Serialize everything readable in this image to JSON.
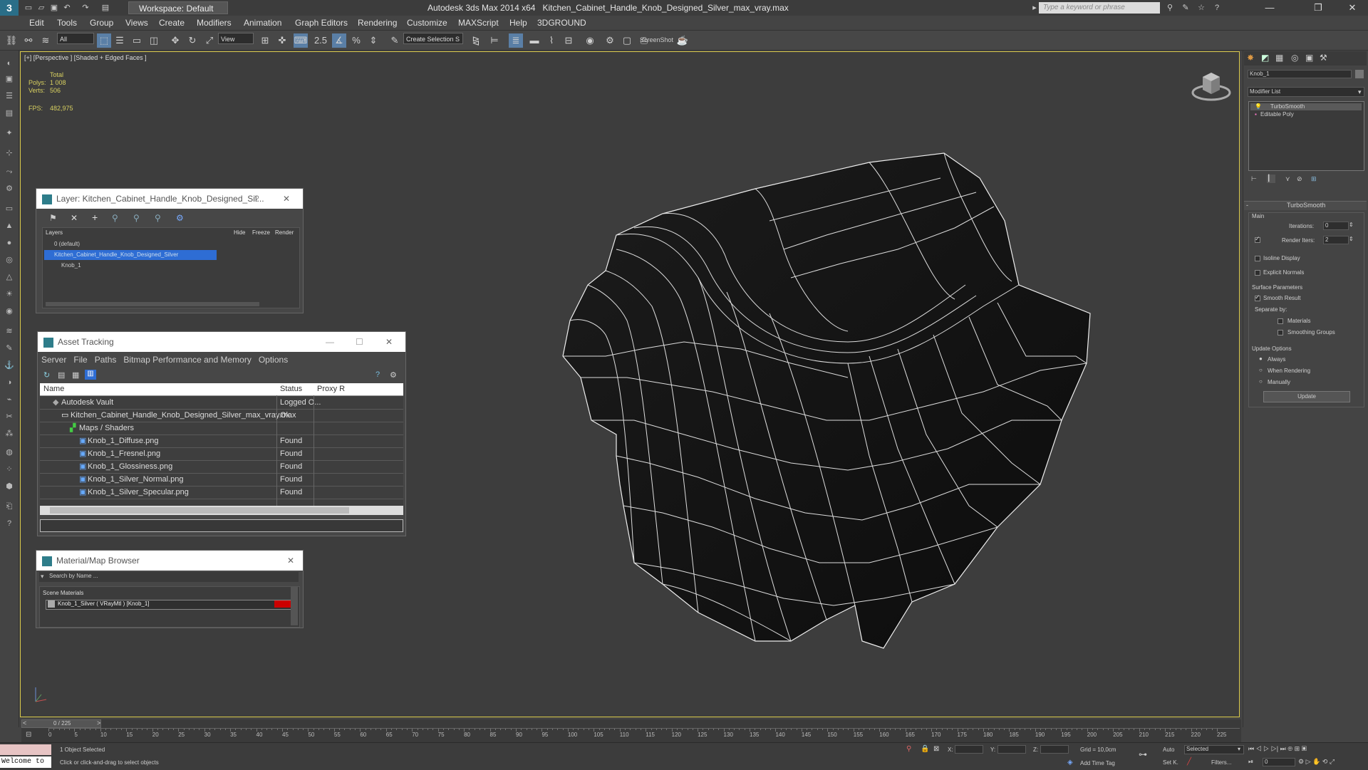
{
  "titlebar": {
    "workspace": "Workspace: Default",
    "app": "Autodesk 3ds Max  2014 x64",
    "file": "Kitchen_Cabinet_Handle_Knob_Designed_Silver_max_vray.max",
    "search_placeholder": "Type a keyword or phrase"
  },
  "menu": [
    "Edit",
    "Tools",
    "Group",
    "Views",
    "Create",
    "Modifiers",
    "Animation",
    "Graph Editors",
    "Rendering",
    "Customize",
    "MAXScript",
    "Help",
    "3DGROUND"
  ],
  "toolbar": {
    "filter": "All",
    "refcoord": "View",
    "selset": "Create Selection S",
    "screenshot": "ScreenShot"
  },
  "viewport": {
    "label": "[+] [Perspective ] [Shaded + Edged Faces ]",
    "stats_total": "Total",
    "polys_label": "Polys:",
    "polys_value": "1 008",
    "verts_label": "Verts:",
    "verts_value": "506",
    "fps_label": "FPS:",
    "fps_value": "482,975"
  },
  "layer_dialog": {
    "title": "Layer: Kitchen_Cabinet_Handle_Knob_Designed_Sil...",
    "col_layers": "Layers",
    "col_hide": "Hide",
    "col_freeze": "Freeze",
    "col_render": "Render",
    "rows": [
      "0 (default)",
      "Kitchen_Cabinet_Handle_Knob_Designed_Silver",
      "Knob_1"
    ]
  },
  "asset_dialog": {
    "title": "Asset Tracking",
    "menus": [
      "Server",
      "File",
      "Paths",
      "Bitmap Performance and Memory",
      "Options"
    ],
    "col_name": "Name",
    "col_status": "Status",
    "col_proxy": "Proxy R",
    "rows": [
      {
        "name": "Autodesk Vault",
        "status": "Logged O..."
      },
      {
        "name": "Kitchen_Cabinet_Handle_Knob_Designed_Silver_max_vray.max",
        "status": "Ok"
      },
      {
        "name": "Maps / Shaders",
        "status": ""
      },
      {
        "name": "Knob_1_Diffuse.png",
        "status": "Found"
      },
      {
        "name": "Knob_1_Fresnel.png",
        "status": "Found"
      },
      {
        "name": "Knob_1_Glossiness.png",
        "status": "Found"
      },
      {
        "name": "Knob_1_Silver_Normal.png",
        "status": "Found"
      },
      {
        "name": "Knob_1_Silver_Specular.png",
        "status": "Found"
      }
    ]
  },
  "material_dialog": {
    "title": "Material/Map Browser",
    "search": "Search by Name ...",
    "group": "Scene Materials",
    "item": "Knob_1_Silver  ( VRayMtl )  [Knob_1]"
  },
  "right_panel": {
    "object_name": "Knob_1",
    "modifier_list": "Modifier List",
    "stack": [
      "TurboSmooth",
      "Editable Poly"
    ],
    "rollout": "TurboSmooth",
    "main": "Main",
    "iterations_label": "Iterations:",
    "iterations_value": "0",
    "render_iters_label": "Render Iters:",
    "render_iters_value": "2",
    "isoline": "Isoline Display",
    "explicit": "Explicit Normals",
    "surface": "Surface Parameters",
    "smooth": "Smooth Result",
    "separate": "Separate by:",
    "materials": "Materials",
    "smoothing_groups": "Smoothing Groups",
    "update_options": "Update Options",
    "always": "Always",
    "when_rendering": "When Rendering",
    "manually": "Manually",
    "update": "Update"
  },
  "timeline": {
    "frame": "0 / 225",
    "ticks": [
      "0",
      "5",
      "10",
      "15",
      "20",
      "25",
      "30",
      "35",
      "40",
      "45",
      "50",
      "55",
      "60",
      "65",
      "70",
      "75",
      "80",
      "85",
      "90",
      "95",
      "100",
      "105",
      "110",
      "115",
      "120",
      "125",
      "130",
      "135",
      "140",
      "145",
      "150",
      "155",
      "160",
      "165",
      "170",
      "175",
      "180",
      "185",
      "190",
      "195",
      "200",
      "205",
      "210",
      "215",
      "220",
      "225"
    ]
  },
  "status": {
    "maxscript": "Welcome to",
    "selected": "1 Object Selected",
    "prompt": "Click or click-and-drag to select objects",
    "x_label": "X:",
    "y_label": "Y:",
    "z_label": "Z:",
    "grid": "Grid = 10,0cm",
    "add_time_tag": "Add Time Tag",
    "auto": "Auto",
    "setk": "Set K.",
    "selected_combo": "Selected",
    "filters": "Filters...",
    "frame_field": "0"
  }
}
